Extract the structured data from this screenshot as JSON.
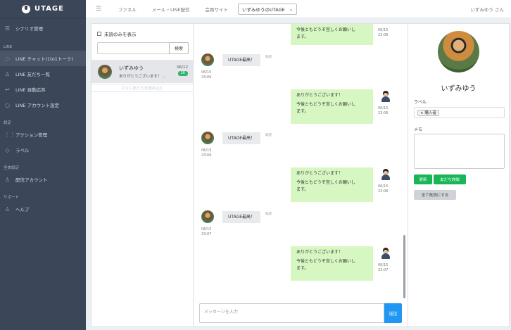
{
  "app": {
    "logo": "UTAGE"
  },
  "sidebar": {
    "items": [
      {
        "id": "scenario",
        "label": "シナリオ管理",
        "icon": "list-icon",
        "glyph": "☰"
      }
    ],
    "sections": [
      {
        "title": "LINE",
        "items": [
          {
            "label": "LINE チャット(1to1トーク)",
            "icon": "chat-icon",
            "glyph": "◌"
          },
          {
            "label": "LINE 友だち一覧",
            "icon": "user-icon",
            "glyph": "♙"
          },
          {
            "label": "LINE 自動応答",
            "icon": "reply-icon",
            "glyph": "↩"
          },
          {
            "label": "LINE アカウント設定",
            "icon": "search-icon",
            "glyph": "○"
          }
        ]
      },
      {
        "title": "設定",
        "items": [
          {
            "label": "アクション管理",
            "icon": "grid-icon",
            "glyph": "⋮⋮"
          },
          {
            "label": "ラベル",
            "icon": "tag-icon",
            "glyph": "◇"
          }
        ]
      },
      {
        "title": "全体設定",
        "items": [
          {
            "label": "配信アカウント",
            "icon": "user-icon",
            "glyph": "♙"
          }
        ]
      },
      {
        "title": "サポート",
        "items": [
          {
            "label": "ヘルプ",
            "icon": "user-icon",
            "glyph": "♙"
          }
        ]
      }
    ]
  },
  "topbar": {
    "links": [
      "ファネル",
      "メール・LINE配信",
      "会員サイト"
    ],
    "account_select": "いずみゆうのUTAGE",
    "user": "いずみゆう さん"
  },
  "chat_list": {
    "unread_only_label": "未読のみを表示",
    "search_button": "検索",
    "search_value": "",
    "items": [
      {
        "name": "いずみゆう",
        "preview": "ありがとうございます！...",
        "date": "06/12",
        "badge": "26"
      }
    ],
    "load_more": "さらに友だちを読み込む"
  },
  "messages": {
    "items": [
      {
        "dir": "out",
        "lines": [
          "今後ともどうぞ宜しくお願いし",
          "ます。"
        ],
        "date": "06/15",
        "time": "23:06"
      },
      {
        "dir": "in",
        "text": "UTAGE最高！",
        "read": "既読",
        "date": "06/15",
        "time": "23:06"
      },
      {
        "dir": "out",
        "lines": [
          "ありがとうございます！",
          "",
          "今後ともどうぞ宜しくお願いし",
          "ます。"
        ],
        "date": "06/15",
        "time": "23:06"
      },
      {
        "dir": "in",
        "text": "UTAGE最高！",
        "read": "既読",
        "date": "06/15",
        "time": "23:06"
      },
      {
        "dir": "out",
        "lines": [
          "ありがとうございます！",
          "",
          "今後ともどうぞ宜しくお願いし",
          "ます。"
        ],
        "date": "06/15",
        "time": "23:06"
      },
      {
        "dir": "in",
        "text": "UTAGE最高！",
        "read": "既読",
        "date": "06/15",
        "time": "23:07"
      },
      {
        "dir": "out",
        "lines": [
          "ありがとうございます！",
          "",
          "今後ともどうぞ宜しくお願いし",
          "ます。"
        ],
        "date": "06/15",
        "time": "23:07"
      }
    ],
    "input_placeholder": "メッセージを入力",
    "send_label": "送信"
  },
  "profile": {
    "name": "いずみゆう",
    "label_title": "ラベル",
    "label_tag": "× 購入者",
    "memo_title": "メモ",
    "memo_value": "",
    "update_button": "更新",
    "friend_detail_button": "友だち詳細",
    "mark_read_button": "全て既読にする"
  },
  "colors": {
    "sidebar_bg": "#3b4659",
    "bubble_out": "#d7f7c2",
    "bubble_in": "#e8eaee",
    "primary_green": "#18b657",
    "send_blue": "#1f97f3"
  }
}
